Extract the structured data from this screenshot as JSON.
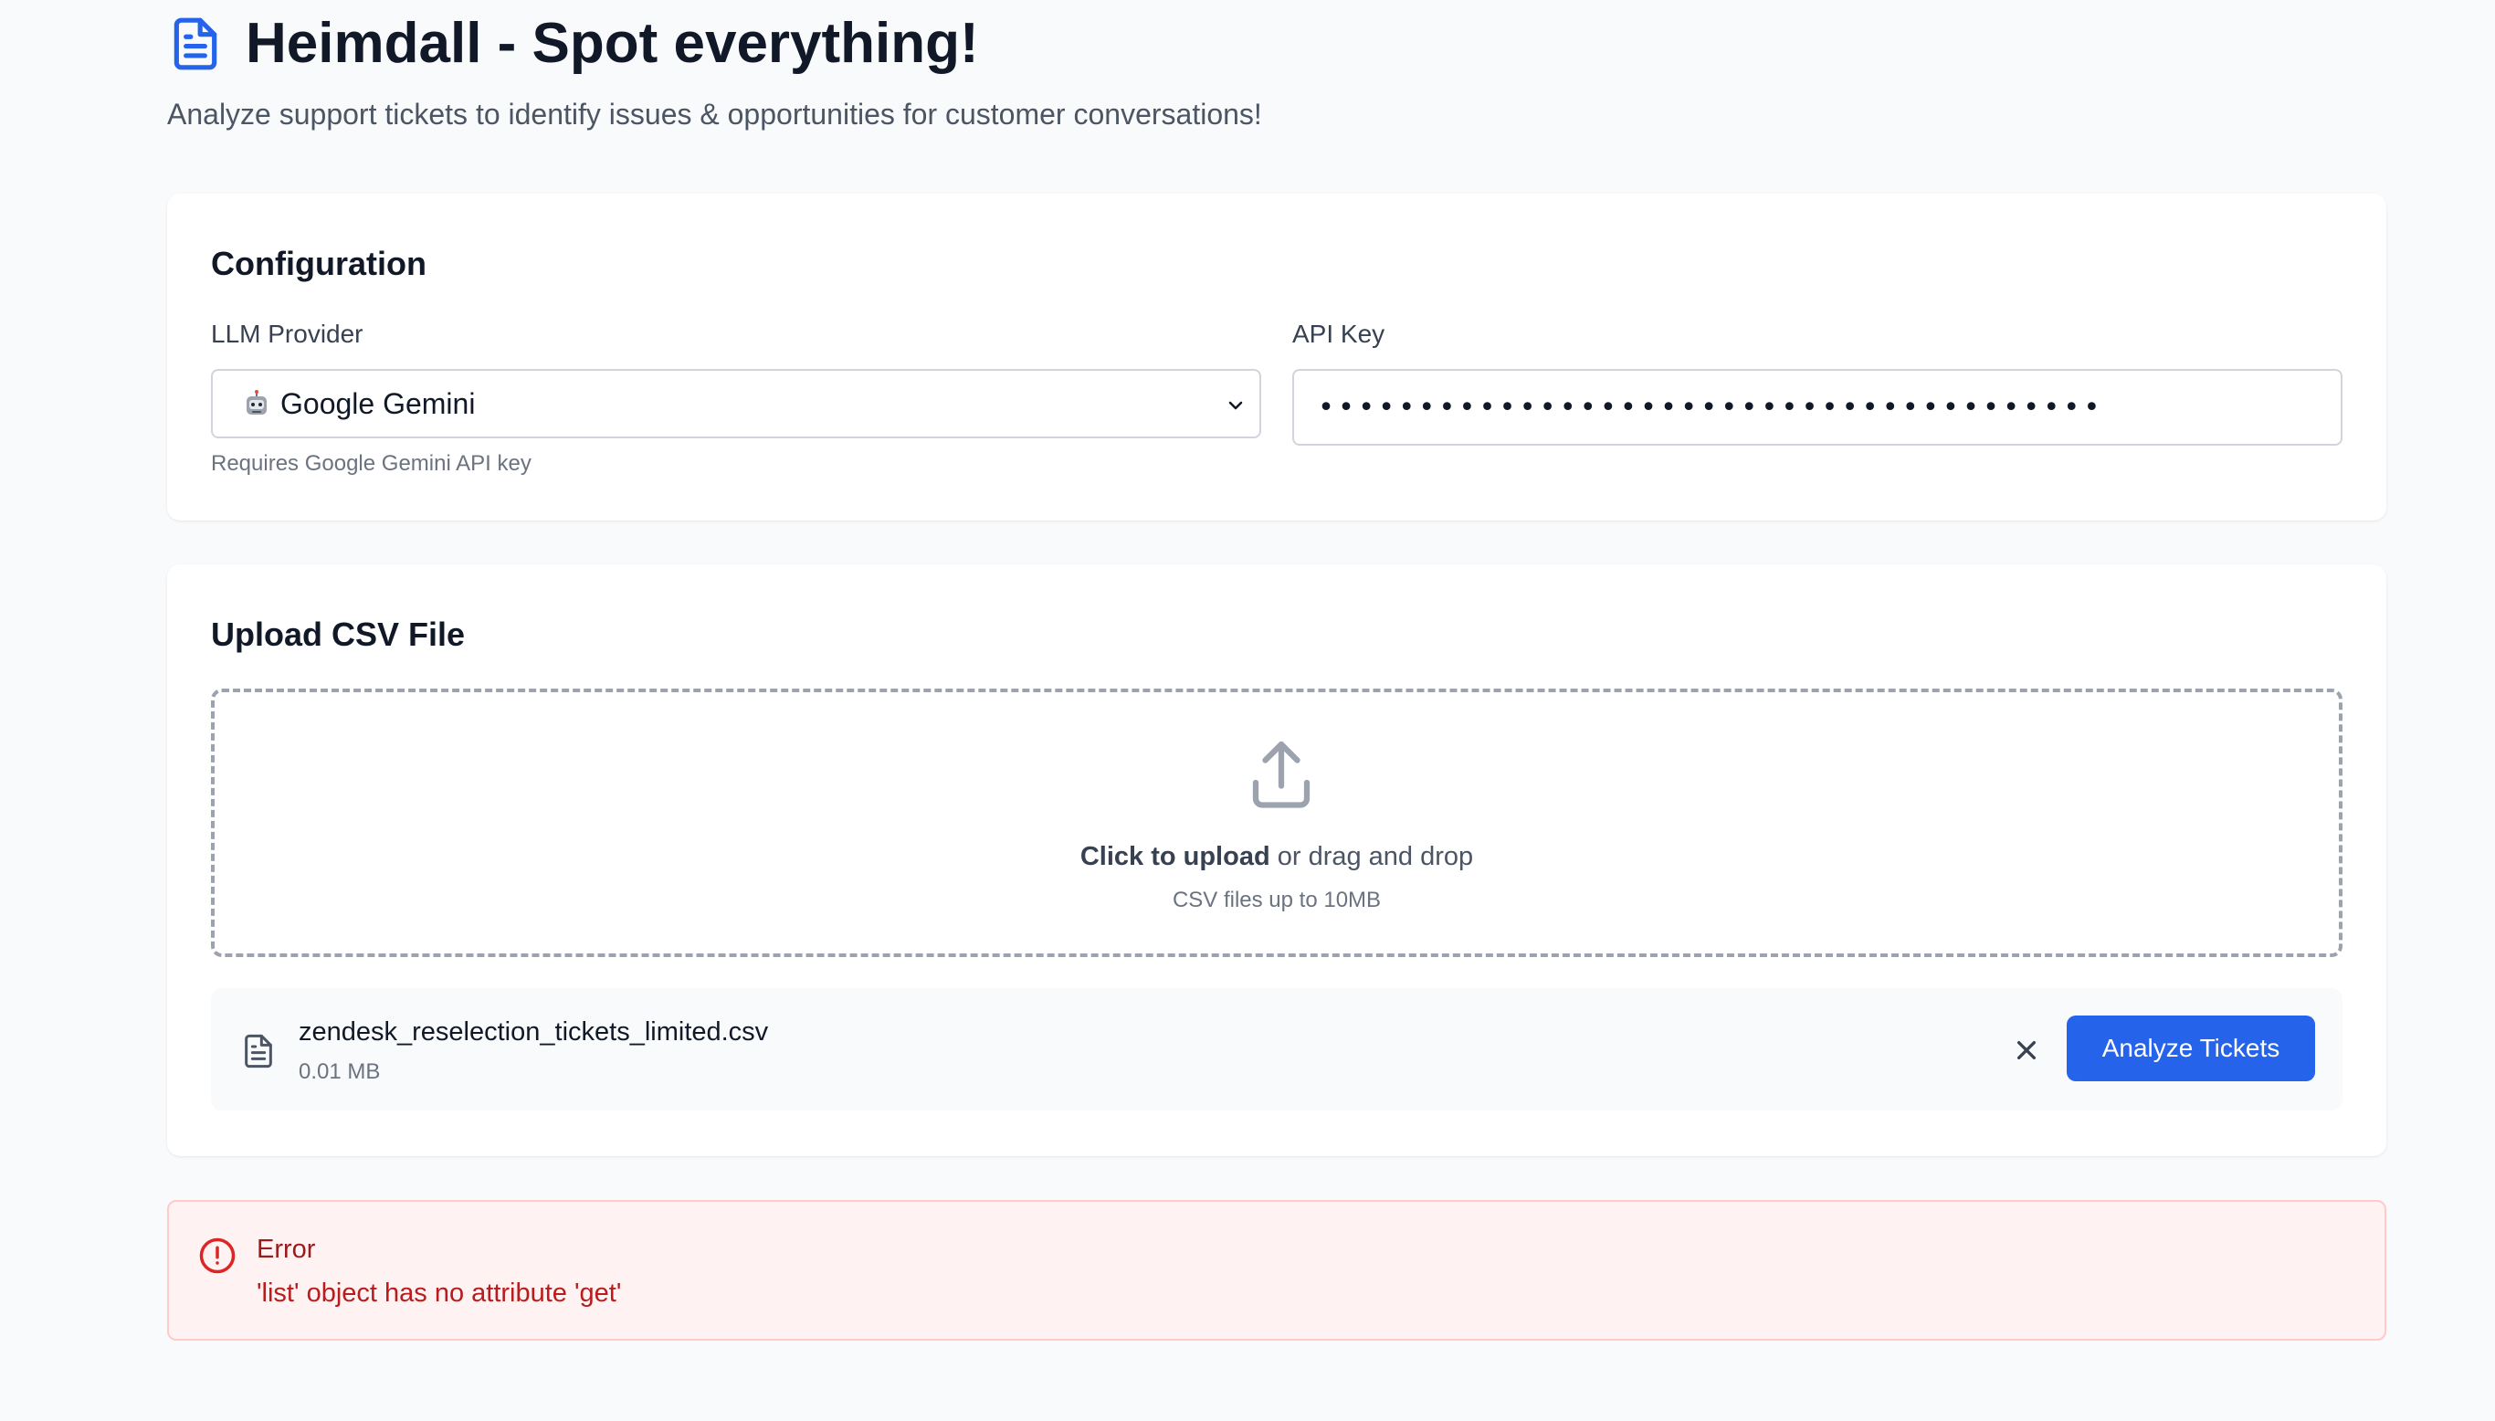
{
  "header": {
    "title": "Heimdall - Spot everything!",
    "subtitle": "Analyze support tickets to identify issues & opportunities for customer conversations!",
    "icon": "document-icon"
  },
  "configuration": {
    "title": "Configuration",
    "provider": {
      "label": "LLM Provider",
      "selected_emoji": "robot-icon",
      "selected_value": "Google Gemini",
      "hint": "Requires Google Gemini API key"
    },
    "api_key": {
      "label": "API Key",
      "value": "•••••••••••••••••••••••••••••••••••••••"
    }
  },
  "upload": {
    "title": "Upload CSV File",
    "dropzone": {
      "action_text": "Click to upload",
      "rest_text": " or drag and drop",
      "hint": "CSV files up to 10MB"
    },
    "file": {
      "name": "zendesk_reselection_tickets_limited.csv",
      "size": "0.01 MB"
    },
    "analyze_label": "Analyze Tickets"
  },
  "error": {
    "title": "Error",
    "message": "'list' object has no attribute 'get'"
  },
  "colors": {
    "accent": "#2563eb",
    "error_text": "#991b1b",
    "error_bg": "#fef2f2",
    "icon_blue": "#2563eb"
  }
}
